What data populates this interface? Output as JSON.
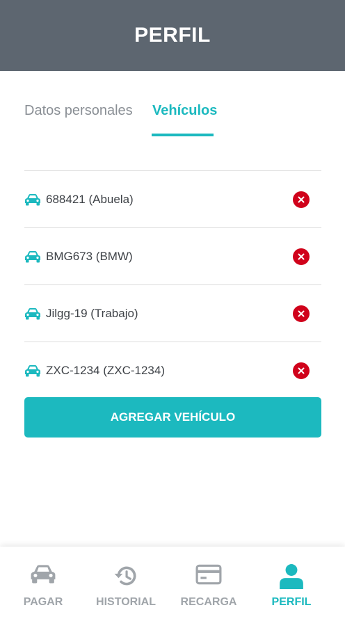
{
  "header": {
    "title": "PERFIL"
  },
  "tabs": [
    {
      "label": "Datos personales",
      "active": false
    },
    {
      "label": "Vehículos",
      "active": true
    }
  ],
  "vehicles": [
    {
      "label": "688421 (Abuela)"
    },
    {
      "label": "BMG673 (BMW)"
    },
    {
      "label": "Jilgg-19 (Trabajo)"
    },
    {
      "label": "ZXC-1234 (ZXC-1234)"
    }
  ],
  "add_button": {
    "label": "AGREGAR VEHÍCULO"
  },
  "bottom_nav": [
    {
      "label": "PAGAR",
      "icon": "car-icon",
      "active": false
    },
    {
      "label": "HISTORIAL",
      "icon": "history-icon",
      "active": false
    },
    {
      "label": "RECARGA",
      "icon": "credit-card-icon",
      "active": false
    },
    {
      "label": "PERFIL",
      "icon": "user-icon",
      "active": true
    }
  ],
  "colors": {
    "header_bg": "#5d6670",
    "accent": "#1cb9bf",
    "delete": "#d0021b",
    "inactive_text": "#a0a5aa"
  }
}
